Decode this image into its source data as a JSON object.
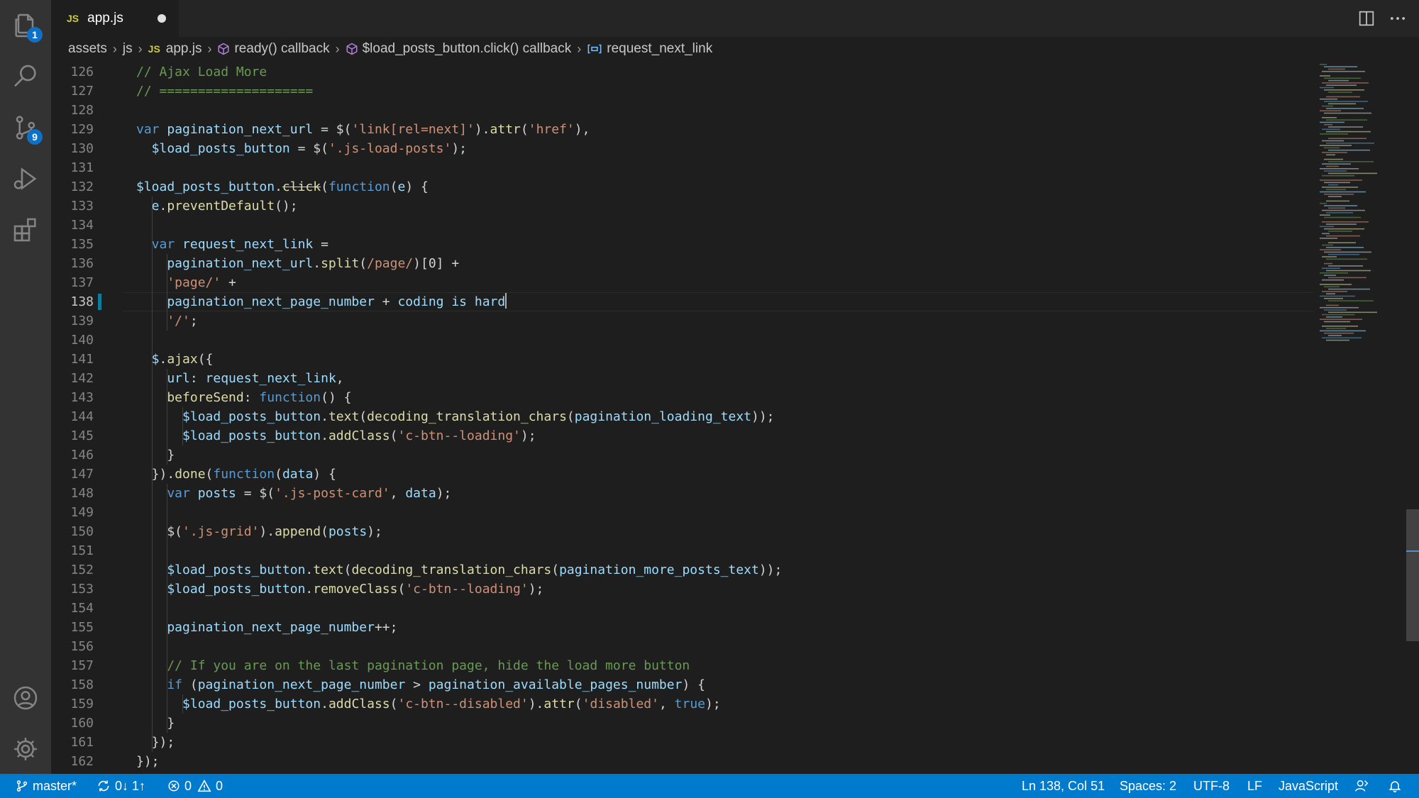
{
  "activity_bar": {
    "explorer_badge": "1",
    "source_control_badge": "9"
  },
  "tab": {
    "lang_tag": "JS",
    "filename": "app.js"
  },
  "breadcrumb": {
    "items": [
      "assets",
      "js",
      "app.js",
      "ready() callback",
      "$load_posts_button.click() callback",
      "request_next_link"
    ],
    "lang_tag": "JS"
  },
  "editor": {
    "current_line": 138,
    "lines": [
      {
        "n": 126,
        "tokens": [
          {
            "t": "// Ajax Load More",
            "c": "c"
          }
        ]
      },
      {
        "n": 127,
        "tokens": [
          {
            "t": "// ====================",
            "c": "c"
          }
        ]
      },
      {
        "n": 128,
        "tokens": []
      },
      {
        "n": 129,
        "tokens": [
          {
            "t": "var ",
            "c": "k"
          },
          {
            "t": "pagination_next_url",
            "c": "v"
          },
          {
            "t": " = $(",
            "c": ""
          },
          {
            "t": "'link[rel=next]'",
            "c": "s"
          },
          {
            "t": ").",
            "c": ""
          },
          {
            "t": "attr",
            "c": "f"
          },
          {
            "t": "(",
            "c": ""
          },
          {
            "t": "'href'",
            "c": "s"
          },
          {
            "t": "),",
            "c": ""
          }
        ]
      },
      {
        "n": 130,
        "tokens": [
          {
            "t": "  $load_posts_button",
            "c": "v"
          },
          {
            "t": " = $(",
            "c": ""
          },
          {
            "t": "'.js-load-posts'",
            "c": "s"
          },
          {
            "t": ");",
            "c": ""
          }
        ]
      },
      {
        "n": 131,
        "tokens": []
      },
      {
        "n": 132,
        "tokens": [
          {
            "t": "$load_posts_button",
            "c": "v"
          },
          {
            "t": ".",
            "c": ""
          },
          {
            "t": "click",
            "c": "fs"
          },
          {
            "t": "(",
            "c": ""
          },
          {
            "t": "function",
            "c": "k"
          },
          {
            "t": "(",
            "c": ""
          },
          {
            "t": "e",
            "c": "v"
          },
          {
            "t": ") {",
            "c": ""
          }
        ]
      },
      {
        "n": 133,
        "tokens": [
          {
            "t": "  e",
            "c": "v"
          },
          {
            "t": ".",
            "c": ""
          },
          {
            "t": "preventDefault",
            "c": "f"
          },
          {
            "t": "();",
            "c": ""
          }
        ]
      },
      {
        "n": 134,
        "tokens": []
      },
      {
        "n": 135,
        "tokens": [
          {
            "t": "  var ",
            "c": "k"
          },
          {
            "t": "request_next_link",
            "c": "v"
          },
          {
            "t": " =",
            "c": ""
          }
        ]
      },
      {
        "n": 136,
        "tokens": [
          {
            "t": "    pagination_next_url",
            "c": "v"
          },
          {
            "t": ".",
            "c": ""
          },
          {
            "t": "split",
            "c": "f"
          },
          {
            "t": "(",
            "c": ""
          },
          {
            "t": "/page/",
            "c": "s"
          },
          {
            "t": ")[0] +",
            "c": ""
          }
        ]
      },
      {
        "n": 137,
        "tokens": [
          {
            "t": "    'page/'",
            "c": "s"
          },
          {
            "t": " +",
            "c": ""
          }
        ]
      },
      {
        "n": 138,
        "tokens": [
          {
            "t": "    pagination_next_page_number",
            "c": "v"
          },
          {
            "t": " + ",
            "c": ""
          },
          {
            "t": "coding",
            "c": "v"
          },
          {
            "t": " ",
            "c": ""
          },
          {
            "t": "is",
            "c": "v"
          },
          {
            "t": " ",
            "c": ""
          },
          {
            "t": "hard",
            "c": "v"
          }
        ]
      },
      {
        "n": 139,
        "tokens": [
          {
            "t": "    '/'",
            "c": "s"
          },
          {
            "t": ";",
            "c": ""
          }
        ]
      },
      {
        "n": 140,
        "tokens": []
      },
      {
        "n": 141,
        "tokens": [
          {
            "t": "  $",
            "c": "v"
          },
          {
            "t": ".",
            "c": ""
          },
          {
            "t": "ajax",
            "c": "f"
          },
          {
            "t": "({",
            "c": ""
          }
        ]
      },
      {
        "n": 142,
        "tokens": [
          {
            "t": "    url",
            "c": "v"
          },
          {
            "t": ": ",
            "c": ""
          },
          {
            "t": "request_next_link",
            "c": "v"
          },
          {
            "t": ",",
            "c": ""
          }
        ]
      },
      {
        "n": 143,
        "tokens": [
          {
            "t": "    beforeSend",
            "c": "f"
          },
          {
            "t": ": ",
            "c": ""
          },
          {
            "t": "function",
            "c": "k"
          },
          {
            "t": "() {",
            "c": ""
          }
        ]
      },
      {
        "n": 144,
        "tokens": [
          {
            "t": "      $load_posts_button",
            "c": "v"
          },
          {
            "t": ".",
            "c": ""
          },
          {
            "t": "text",
            "c": "f"
          },
          {
            "t": "(",
            "c": ""
          },
          {
            "t": "decoding_translation_chars",
            "c": "f"
          },
          {
            "t": "(",
            "c": ""
          },
          {
            "t": "pagination_loading_text",
            "c": "v"
          },
          {
            "t": "));",
            "c": ""
          }
        ]
      },
      {
        "n": 145,
        "tokens": [
          {
            "t": "      $load_posts_button",
            "c": "v"
          },
          {
            "t": ".",
            "c": ""
          },
          {
            "t": "addClass",
            "c": "f"
          },
          {
            "t": "(",
            "c": ""
          },
          {
            "t": "'c-btn--loading'",
            "c": "s"
          },
          {
            "t": ");",
            "c": ""
          }
        ]
      },
      {
        "n": 146,
        "tokens": [
          {
            "t": "    }",
            "c": ""
          }
        ]
      },
      {
        "n": 147,
        "tokens": [
          {
            "t": "  }).",
            "c": ""
          },
          {
            "t": "done",
            "c": "f"
          },
          {
            "t": "(",
            "c": ""
          },
          {
            "t": "function",
            "c": "k"
          },
          {
            "t": "(",
            "c": ""
          },
          {
            "t": "data",
            "c": "v"
          },
          {
            "t": ") {",
            "c": ""
          }
        ]
      },
      {
        "n": 148,
        "tokens": [
          {
            "t": "    var ",
            "c": "k"
          },
          {
            "t": "posts",
            "c": "v"
          },
          {
            "t": " = $(",
            "c": ""
          },
          {
            "t": "'.js-post-card'",
            "c": "s"
          },
          {
            "t": ", ",
            "c": ""
          },
          {
            "t": "data",
            "c": "v"
          },
          {
            "t": ");",
            "c": ""
          }
        ]
      },
      {
        "n": 149,
        "tokens": []
      },
      {
        "n": 150,
        "tokens": [
          {
            "t": "    $(",
            "c": ""
          },
          {
            "t": "'.js-grid'",
            "c": "s"
          },
          {
            "t": ").",
            "c": ""
          },
          {
            "t": "append",
            "c": "f"
          },
          {
            "t": "(",
            "c": ""
          },
          {
            "t": "posts",
            "c": "v"
          },
          {
            "t": ");",
            "c": ""
          }
        ]
      },
      {
        "n": 151,
        "tokens": []
      },
      {
        "n": 152,
        "tokens": [
          {
            "t": "    $load_posts_button",
            "c": "v"
          },
          {
            "t": ".",
            "c": ""
          },
          {
            "t": "text",
            "c": "f"
          },
          {
            "t": "(",
            "c": ""
          },
          {
            "t": "decoding_translation_chars",
            "c": "f"
          },
          {
            "t": "(",
            "c": ""
          },
          {
            "t": "pagination_more_posts_text",
            "c": "v"
          },
          {
            "t": "));",
            "c": ""
          }
        ]
      },
      {
        "n": 153,
        "tokens": [
          {
            "t": "    $load_posts_button",
            "c": "v"
          },
          {
            "t": ".",
            "c": ""
          },
          {
            "t": "removeClass",
            "c": "f"
          },
          {
            "t": "(",
            "c": ""
          },
          {
            "t": "'c-btn--loading'",
            "c": "s"
          },
          {
            "t": ");",
            "c": ""
          }
        ]
      },
      {
        "n": 154,
        "tokens": []
      },
      {
        "n": 155,
        "tokens": [
          {
            "t": "    pagination_next_page_number",
            "c": "v"
          },
          {
            "t": "++;",
            "c": ""
          }
        ]
      },
      {
        "n": 156,
        "tokens": []
      },
      {
        "n": 157,
        "tokens": [
          {
            "t": "    // If you are on the last pagination page, hide the load more button",
            "c": "c"
          }
        ]
      },
      {
        "n": 158,
        "tokens": [
          {
            "t": "    if ",
            "c": "k"
          },
          {
            "t": "(",
            "c": ""
          },
          {
            "t": "pagination_next_page_number",
            "c": "v"
          },
          {
            "t": " > ",
            "c": ""
          },
          {
            "t": "pagination_available_pages_number",
            "c": "v"
          },
          {
            "t": ") {",
            "c": ""
          }
        ]
      },
      {
        "n": 159,
        "tokens": [
          {
            "t": "      $load_posts_button",
            "c": "v"
          },
          {
            "t": ".",
            "c": ""
          },
          {
            "t": "addClass",
            "c": "f"
          },
          {
            "t": "(",
            "c": ""
          },
          {
            "t": "'c-btn--disabled'",
            "c": "s"
          },
          {
            "t": ").",
            "c": ""
          },
          {
            "t": "attr",
            "c": "f"
          },
          {
            "t": "(",
            "c": ""
          },
          {
            "t": "'disabled'",
            "c": "s"
          },
          {
            "t": ", ",
            "c": ""
          },
          {
            "t": "true",
            "c": "k"
          },
          {
            "t": ");",
            "c": ""
          }
        ]
      },
      {
        "n": 160,
        "tokens": [
          {
            "t": "    }",
            "c": ""
          }
        ]
      },
      {
        "n": 161,
        "tokens": [
          {
            "t": "  });",
            "c": ""
          }
        ]
      },
      {
        "n": 162,
        "tokens": [
          {
            "t": "});",
            "c": ""
          }
        ]
      }
    ]
  },
  "statusbar": {
    "branch": "master*",
    "sync": "0↓ 1↑",
    "errors": "0",
    "warnings": "0",
    "position": "Ln 138, Col 51",
    "spaces": "Spaces: 2",
    "encoding": "UTF-8",
    "eol": "LF",
    "language": "JavaScript"
  },
  "colors": {
    "status_bar": "#007acc",
    "activity_bar": "#333333",
    "editor_bg": "#1e1e1e",
    "badge": "#0e71c6"
  }
}
